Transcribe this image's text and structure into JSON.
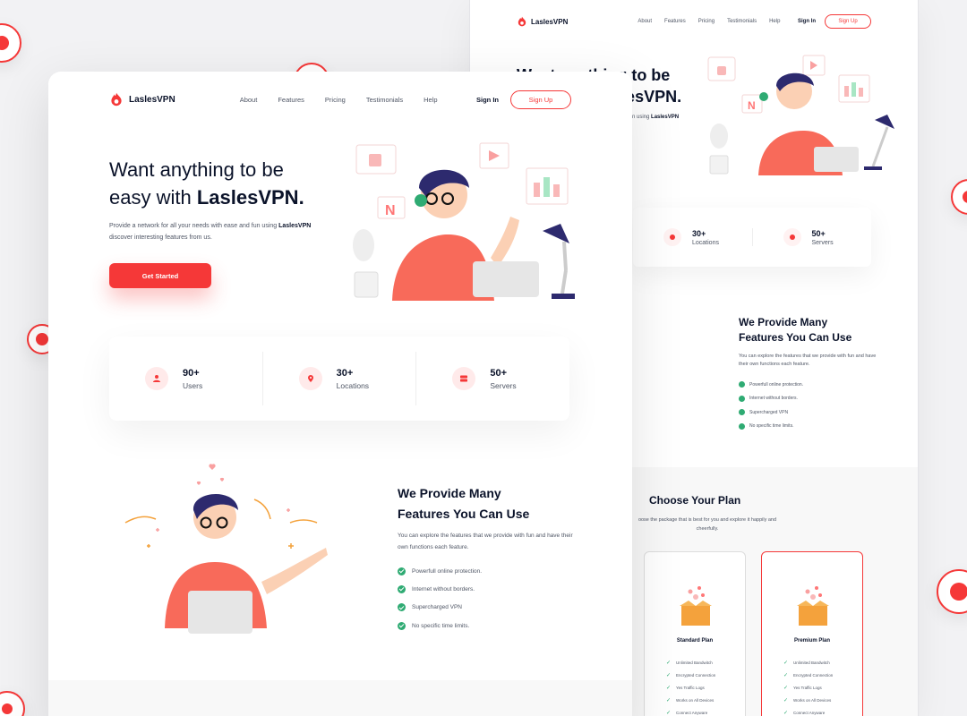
{
  "brand": {
    "name": "LaslesVPN",
    "accent": "#f53838",
    "text": "#0b132a",
    "muted": "#4f5665",
    "success": "#2fab73"
  },
  "nav": {
    "items": [
      "About",
      "Features",
      "Pricing",
      "Testimonials",
      "Help"
    ],
    "sign_in": "Sign In",
    "sign_up": "Sign Up"
  },
  "hero": {
    "title_line1": "Want anything to be",
    "title_line2_prefix": "easy with",
    "title_line2_brand": "LaslesVPN.",
    "desc_prefix": "Provide a network for all your needs with ease and fun using",
    "desc_brand": "LaslesVPN",
    "desc_suffix": "discover interesting features from us.",
    "cta": "Get Started"
  },
  "stats": [
    {
      "icon": "user-icon",
      "value": "90+",
      "label": "Users"
    },
    {
      "icon": "location-pin-icon",
      "value": "30+",
      "label": "Locations"
    },
    {
      "icon": "server-icon",
      "value": "50+",
      "label": "Servers"
    }
  ],
  "features": {
    "title_line1": "We Provide Many",
    "title_line2": "Features You Can Use",
    "desc": "You can explore the features that we provide with fun and have their own functions each feature.",
    "items": [
      "Powerfull online protection.",
      "Internet without borders.",
      "Supercharged VPN",
      "No specific time limits."
    ]
  },
  "back": {
    "hero_title_line1": "Want anything to be",
    "hero_title_line2": "easy with LaslesVPN.",
    "hero_sub_prefix": "fun using",
    "hero_sub_brand": "LaslesVPN",
    "stats": [
      {
        "value": "30+",
        "label": "Locations"
      },
      {
        "value": "50+",
        "label": "Servers"
      }
    ],
    "features_title_line1": "We Provide Many",
    "features_title_line2": "Features You Can Use",
    "features_desc": "You can explore the features that we provide with fun and have their own functions each feature.",
    "features_items": [
      "Powerfull online protection.",
      "Internet without borders.",
      "Supercharged VPN",
      "No specific time limits."
    ],
    "plans_title": "Choose Your Plan",
    "plans_desc": "oose the package that is best for you and explore it happily and cheerfully.",
    "plans": [
      {
        "name": "Standard Plan",
        "features": [
          "Unlimited Bandwitch",
          "Encrypted Connection",
          "Yes Traffic Logs",
          "Works on All Devices",
          "Connect Anyware"
        ]
      },
      {
        "name": "Premium Plan",
        "features": [
          "Unlimited Bandwitch",
          "Encrypted Connection",
          "Yes Traffic Logs",
          "Works on All Devices",
          "Connect Anyware"
        ]
      }
    ]
  }
}
